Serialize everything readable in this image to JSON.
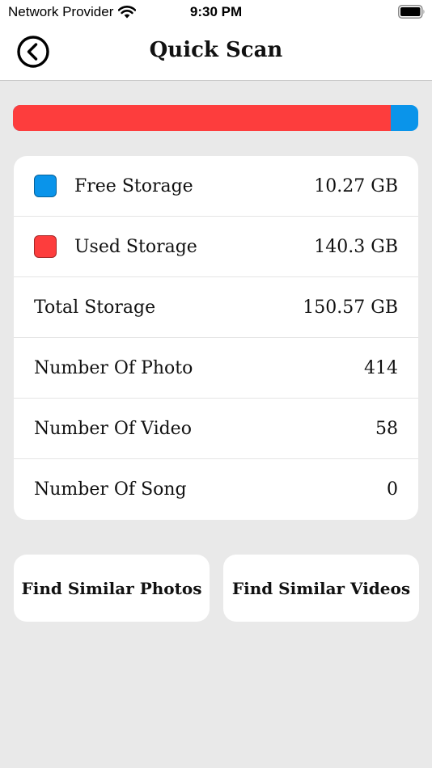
{
  "status_bar": {
    "carrier": "Network Provider",
    "time": "9:30 PM"
  },
  "nav": {
    "title": "Quick Scan",
    "back_icon": "chevron-left-circle-icon"
  },
  "storage_bar": {
    "used_fraction": 0.932,
    "used_color": "#fd3d3d",
    "free_color": "#0a94ea"
  },
  "rows": [
    {
      "label": "Free Storage",
      "value": "10.27 GB",
      "swatch": "#0a94ea"
    },
    {
      "label": "Used Storage",
      "value": "140.3 GB",
      "swatch": "#fd3d3d"
    },
    {
      "label": "Total Storage",
      "value": "150.57 GB"
    },
    {
      "label": "Number Of Photo",
      "value": "414"
    },
    {
      "label": "Number Of Video",
      "value": "58"
    },
    {
      "label": "Number Of Song",
      "value": "0"
    }
  ],
  "buttons": {
    "similar_photos": "Find Similar Photos",
    "similar_videos": "Find Similar Videos"
  }
}
